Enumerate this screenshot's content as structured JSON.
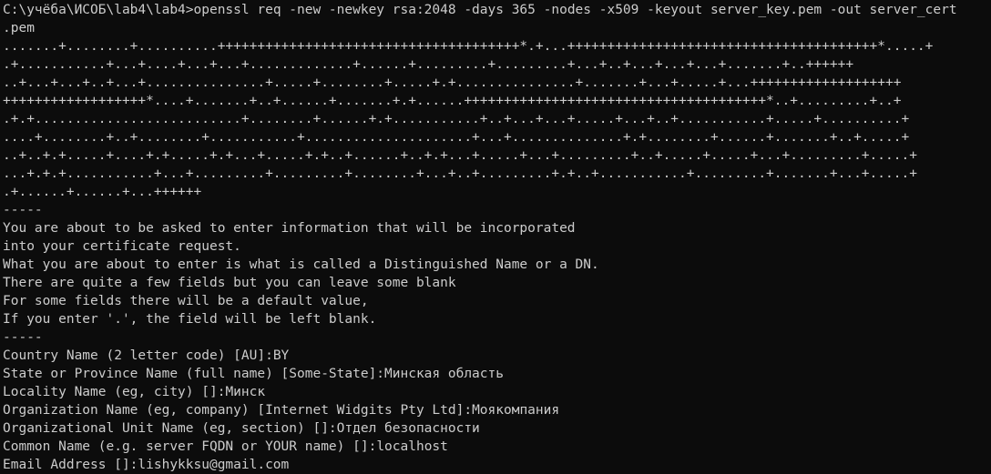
{
  "terminal": {
    "prompt": "C:\\учёба\\ИСОБ\\lab4\\lab4>",
    "command": "openssl req -new -newkey rsa:2048 -days 365 -nodes -x509 -keyout server_key.pem -out server_cert",
    "command_wrap": ".pem",
    "keygen_progress": [
      ".......+........+..........++++++++++++++++++++++++++++++++++++++*.+...+++++++++++++++++++++++++++++++++++++++*.....+",
      ".+...........+...+....+...+...+.............+......+.........+.........+...+..+...+...+...+.......+..++++++",
      "..+...+...+..+...+...............+.....+........+.....+.+...............+.......+...+.....+...+++++++++++++++++++",
      "++++++++++++++++++*....+.......+..+......+.......+.+......++++++++++++++++++++++++++++++++++++++*..+.........+..+",
      ".+.+..........................+........+......+.+...........+..+...+...+.....+...+..+...........+.....+..........+",
      "....+........+..+........+...........+.....................+...+..............+.+........+......+.......+..+.....+",
      "..+..+.+.....+....+.+.....+.+...+.....+.+..+......+..+.+...+.....+...+.........+..+.....+.....+...+.........+.....+",
      "...+.+.+...........+...+.........+.........+........+...+..+.........+.+..+...........+.........+.......+...+.....+",
      ".+......+......+...++++++"
    ],
    "separator_1": "-----",
    "intro_lines": [
      "You are about to be asked to enter information that will be incorporated",
      "into your certificate request.",
      "What you are about to enter is what is called a Distinguished Name or a DN.",
      "There are quite a few fields but you can leave some blank",
      "For some fields there will be a default value,",
      "If you enter '.', the field will be left blank."
    ],
    "separator_2": "-----",
    "fields": [
      {
        "prompt": "Country Name (2 letter code) [AU]:",
        "value": "BY"
      },
      {
        "prompt": "State or Province Name (full name) [Some-State]:",
        "value": "Минская область"
      },
      {
        "prompt": "Locality Name (eg, city) []:",
        "value": "Минск"
      },
      {
        "prompt": "Organization Name (eg, company) [Internet Widgits Pty Ltd]:",
        "value": "Моякомпания"
      },
      {
        "prompt": "Organizational Unit Name (eg, section) []:",
        "value": "Отдел безопасности"
      },
      {
        "prompt": "Common Name (e.g. server FQDN or YOUR name) []:",
        "value": "localhost"
      },
      {
        "prompt": "Email Address []:",
        "value": "lishykksu@gmail.com"
      }
    ]
  }
}
